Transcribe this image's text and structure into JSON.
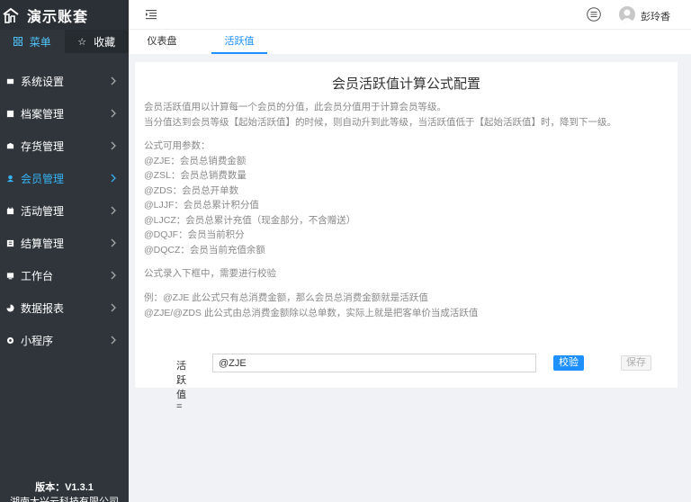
{
  "sidebar": {
    "brand_title": "演示账套",
    "tabs": [
      {
        "label": "菜单",
        "icon": "grid-icon"
      },
      {
        "label": "收藏",
        "icon": "star-icon"
      }
    ],
    "items": [
      {
        "label": "系统设置",
        "icon": "settings-icon"
      },
      {
        "label": "档案管理",
        "icon": "archive-icon"
      },
      {
        "label": "存货管理",
        "icon": "inventory-icon"
      },
      {
        "label": "会员管理",
        "icon": "member-icon",
        "active": true
      },
      {
        "label": "活动管理",
        "icon": "activity-icon"
      },
      {
        "label": "结算管理",
        "icon": "settlement-icon"
      },
      {
        "label": "工作台",
        "icon": "workbench-icon"
      },
      {
        "label": "数据报表",
        "icon": "report-icon"
      },
      {
        "label": "小程序",
        "icon": "miniprogram-icon"
      }
    ],
    "version": "版本：V1.3.1",
    "company": "湖南大兴云科技有限公司"
  },
  "topbar": {
    "username": "彭玲香"
  },
  "tabs": [
    {
      "label": "仪表盘"
    },
    {
      "label": "活跃值",
      "active": true
    }
  ],
  "content": {
    "title": "会员活跃值计算公式配置",
    "intro": [
      "会员活跃值用以计算每一个会员的分值，此会员分值用于计算会员等级。",
      "当分值达到会员等级【起始活跃值】的时候，则自动升到此等级，当活跃值低于【起始活跃值】时，降到下一级。"
    ],
    "params_title": "公式可用参数：",
    "params": [
      "@ZJE：会员总销费金额",
      "@ZSL：会员总销费数量",
      "@ZDS：会员总开单数",
      "@LJJF：会员总累计积分值",
      "@LJCZ：会员总累计充值（现金部分，不含赠送）",
      "@DQJF：会员当前积分",
      "@DQCZ：会员当前充值余额"
    ],
    "note": "公式录入下框中，需要进行校验",
    "examples": [
      "例：@ZJE 此公式只有总消费金额，那么会员总消费金额就是活跃值",
      "@ZJE/@ZDS 此公式由总消费金额除以总单数，实际上就是把客单价当成活跃值"
    ],
    "formula_label": "活跃值=",
    "formula_value": "@ZJE",
    "check_button": "校验",
    "save_button": "保存"
  },
  "colors": {
    "sidebar_bg": "#2f353b",
    "accent": "#1e90ff",
    "active_menu": "#36b3f5"
  }
}
